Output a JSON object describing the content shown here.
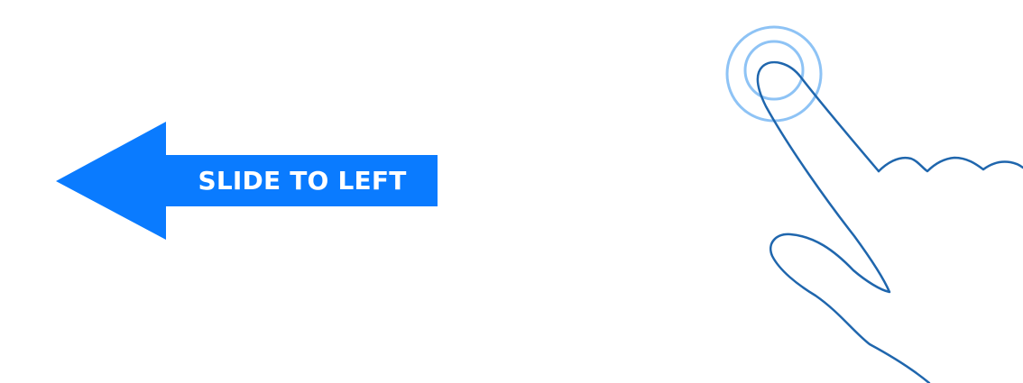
{
  "gesture": {
    "instruction_label": "SLIDE TO LEFT",
    "direction": "left",
    "arrow_icon": "left-arrow-icon",
    "hand_icon": "pointing-hand-icon",
    "touch_icon": "tap-ripple-icon"
  },
  "colors": {
    "background": "#ffffff",
    "arrow_fill": "#0a7bff",
    "label_text": "#ffffff",
    "hand_stroke": "#1f66ad",
    "ripple_stroke": "#8ec3f5"
  }
}
